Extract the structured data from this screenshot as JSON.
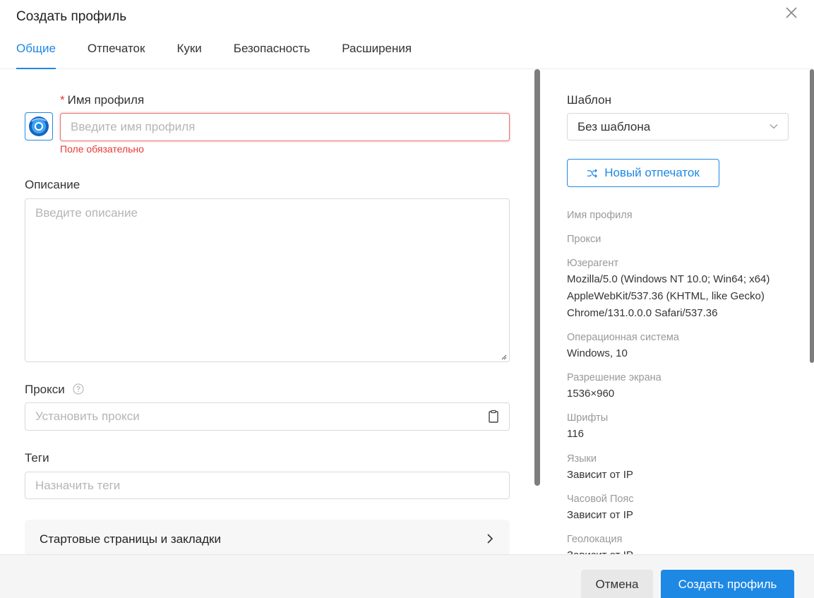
{
  "dialog": {
    "title": "Создать профиль"
  },
  "tabs": [
    {
      "label": "Общие",
      "active": true
    },
    {
      "label": "Отпечаток",
      "active": false
    },
    {
      "label": "Куки",
      "active": false
    },
    {
      "label": "Безопасность",
      "active": false
    },
    {
      "label": "Расширения",
      "active": false
    }
  ],
  "general": {
    "profile_name": {
      "required_mark": "*",
      "label": "Имя профиля",
      "placeholder": "Введите имя профиля",
      "value": "",
      "error": "Поле обязательно"
    },
    "description": {
      "label": "Описание",
      "placeholder": "Введите описание"
    },
    "proxy": {
      "label": "Прокси",
      "placeholder": "Установить прокси"
    },
    "tags": {
      "label": "Теги",
      "placeholder": "Назначить теги"
    },
    "start_pages": {
      "label": "Стартовые страницы и закладки"
    }
  },
  "summary": {
    "template_label": "Шаблон",
    "template_value": "Без шаблона",
    "new_fingerprint": "Новый отпечаток",
    "items": [
      {
        "label": "Имя профиля",
        "value": ""
      },
      {
        "label": "Прокси",
        "value": ""
      },
      {
        "label": "Юзерагент",
        "value": "Mozilla/5.0 (Windows NT 10.0; Win64; x64) AppleWebKit/537.36 (KHTML, like Gecko) Chrome/131.0.0.0 Safari/537.36"
      },
      {
        "label": "Операционная система",
        "value": "Windows, 10"
      },
      {
        "label": "Разрешение экрана",
        "value": "1536×960"
      },
      {
        "label": "Шрифты",
        "value": "116"
      },
      {
        "label": "Языки",
        "value": "Зависит от IP"
      },
      {
        "label": "Часовой Пояс",
        "value": "Зависит от IP"
      },
      {
        "label": "Геолокация",
        "value": "Зависит от IP"
      }
    ]
  },
  "footer": {
    "cancel": "Отмена",
    "create": "Создать профиль"
  },
  "colors": {
    "accent": "#1e88e5",
    "error": "#e53935"
  }
}
